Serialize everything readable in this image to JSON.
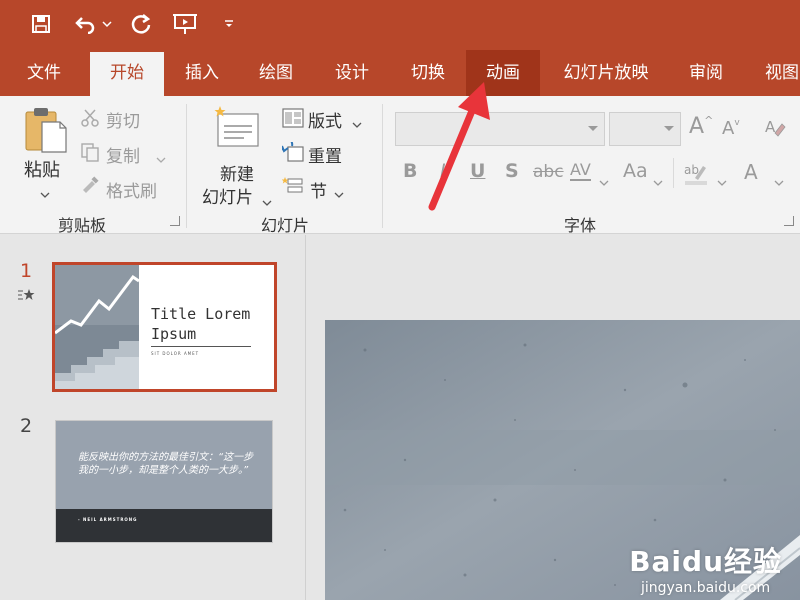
{
  "tabs": [
    "文件",
    "开始",
    "插入",
    "绘图",
    "设计",
    "切换",
    "动画",
    "幻灯片放映",
    "审阅",
    "视图"
  ],
  "clipboard": {
    "paste_label": "粘贴",
    "cut_label": "剪切",
    "copy_label": "复制",
    "format_painter_label": "格式刷",
    "group_label": "剪贴板"
  },
  "slides": {
    "new_slide_line1": "新建",
    "new_slide_line2": "幻灯片",
    "layout_label": "版式",
    "reset_label": "重置",
    "section_label": "节",
    "group_label": "幻灯片"
  },
  "font": {
    "group_label": "字体",
    "bold": "B",
    "italic": "I",
    "underline": "U",
    "shadow": "S",
    "strikethrough": "abc",
    "spacing": "AV",
    "change_case": "Aa",
    "font_color": "A"
  },
  "thumbnails": [
    {
      "number": "1",
      "title_line1": "Title Lorem",
      "title_line2": "Ipsum",
      "subtitle": "SIT DOLOR AMET"
    },
    {
      "number": "2",
      "quote": "能反映出你的方法的最佳引文：“这一步我的一小步，却是整个人类的一大步。”",
      "author": "- NEIL ARMSTRONG"
    }
  ],
  "watermark": {
    "brand": "Baidu经验",
    "url": "jingyan.baidu.com"
  },
  "colors": {
    "accent": "#b7472a",
    "arrow": "#e8343a"
  }
}
